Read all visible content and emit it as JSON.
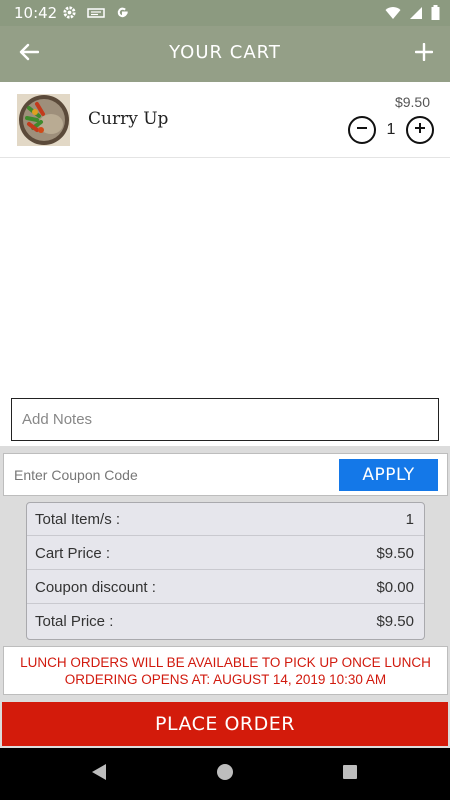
{
  "status_bar": {
    "time": "10:42",
    "left_icons": [
      "gear-icon",
      "news-icon",
      "google-icon"
    ],
    "right_icons": [
      "wifi-icon",
      "signal-icon",
      "battery-icon"
    ]
  },
  "header": {
    "title": "YOUR CART",
    "back_icon": "arrow-left-icon",
    "add_icon": "plus-icon",
    "background": "#949f87"
  },
  "cart": {
    "items": [
      {
        "name": "Curry Up",
        "price": "$9.50",
        "quantity": "1"
      }
    ]
  },
  "notes": {
    "placeholder": "Add Notes"
  },
  "coupon": {
    "placeholder": "Enter Coupon Code",
    "apply_label": "APPLY"
  },
  "summary": {
    "rows": [
      {
        "label": "Total Item/s :",
        "value": "1"
      },
      {
        "label": "Cart Price :",
        "value": "$9.50"
      },
      {
        "label": "Coupon discount :",
        "value": "$0.00"
      },
      {
        "label": "Total Price :",
        "value": "$9.50"
      }
    ]
  },
  "notice": {
    "line1": "LUNCH ORDERS WILL BE AVAILABLE TO PICK UP ONCE LUNCH",
    "line2": "ORDERING OPENS AT: AUGUST 14, 2019 10:30 AM",
    "color": "#d11a0e"
  },
  "place_order": {
    "label": "PLACE ORDER",
    "color": "#d31b0b"
  },
  "colors": {
    "apply": "#1478e8"
  }
}
